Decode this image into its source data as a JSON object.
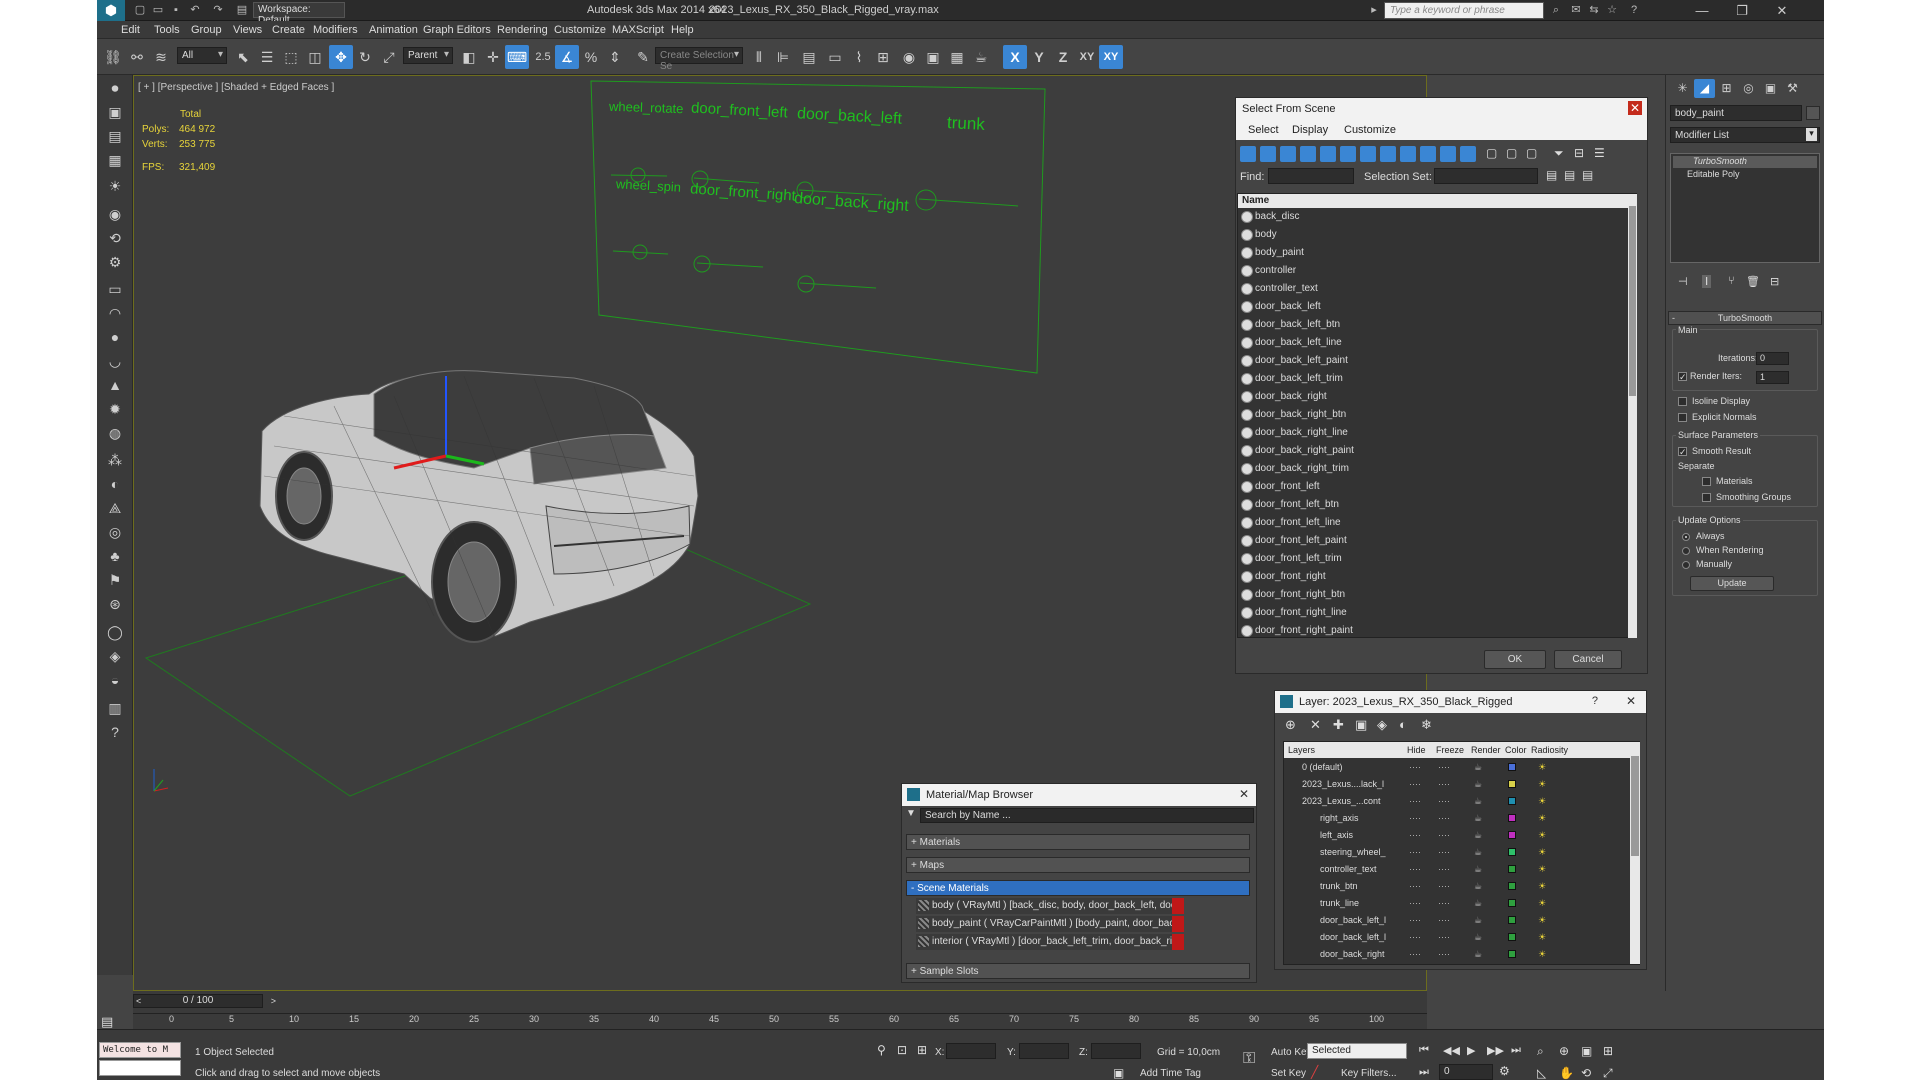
{
  "window": {
    "app_title": "Autodesk 3ds Max  2014 x64",
    "file_name": "2023_Lexus_RX_350_Black_Rigged_vray.max",
    "workspace": "Workspace: Default",
    "search_placeholder": "Type a keyword or phrase"
  },
  "menu": [
    "Edit",
    "Tools",
    "Group",
    "Views",
    "Create",
    "Modifiers",
    "Animation",
    "Graph Editors",
    "Rendering",
    "Customize",
    "MAXScript",
    "Help"
  ],
  "toolbar": {
    "selection_filter": "All",
    "reference_coord": "Parent",
    "snap_value": "2.5",
    "named_selection": "Create Selection Se",
    "axis_x": "X",
    "axis_y": "Y",
    "axis_z": "Z",
    "axis_xy": "XY",
    "axis_xy_active": "XY"
  },
  "viewport": {
    "label": "[ + ] [Perspective ] [Shaded + Edged Faces ]",
    "stats_header": "Total",
    "polys_label": "Polys:",
    "polys_value": "464 972",
    "verts_label": "Verts:",
    "verts_value": "253 775",
    "fps_label": "FPS:",
    "fps_value": "321,409",
    "controller_labels": {
      "wheel_rotate": "wheel_rotate",
      "door_front_left": "door_front_left",
      "door_back_left": "door_back_left",
      "trunk": "trunk",
      "wheel_spin": "wheel_spin",
      "door_front_right": "door_front_right",
      "door_back_right": "door_back_right"
    }
  },
  "select_from_scene": {
    "title": "Select From Scene",
    "menus": [
      "Select",
      "Display",
      "Customize"
    ],
    "find_label": "Find:",
    "selection_set_label": "Selection Set:",
    "column_name": "Name",
    "items": [
      "back_disc",
      "body",
      "body_paint",
      "controller",
      "controller_text",
      "door_back_left",
      "door_back_left_btn",
      "door_back_left_line",
      "door_back_left_paint",
      "door_back_left_trim",
      "door_back_right",
      "door_back_right_btn",
      "door_back_right_line",
      "door_back_right_paint",
      "door_back_right_trim",
      "door_front_left",
      "door_front_left_btn",
      "door_front_left_line",
      "door_front_left_paint",
      "door_front_left_trim",
      "door_front_right",
      "door_front_right_btn",
      "door_front_right_line",
      "door_front_right_paint"
    ],
    "ok": "OK",
    "cancel": "Cancel"
  },
  "layer_dialog": {
    "title": "Layer: 2023_Lexus_RX_350_Black_Rigged",
    "help": "?",
    "columns": [
      "Layers",
      "Hide",
      "Freeze",
      "Render",
      "Color",
      "Radiosity"
    ],
    "rows": [
      {
        "name": "0 (default)",
        "color": "#4a6fd8"
      },
      {
        "name": "2023_Lexus....lack_l",
        "color": "#d8d04a"
      },
      {
        "name": "2023_Lexus_...cont",
        "color": "#1f8fb0"
      },
      {
        "name": "right_axis",
        "color": "#c02fc0"
      },
      {
        "name": "left_axis",
        "color": "#c02fc0"
      },
      {
        "name": "steering_wheel_",
        "color": "#2fc06a"
      },
      {
        "name": "controller_text",
        "color": "#2fa03f"
      },
      {
        "name": "trunk_btn",
        "color": "#2fa03f"
      },
      {
        "name": "trunk_line",
        "color": "#2fa03f"
      },
      {
        "name": "door_back_left_l",
        "color": "#2fa03f"
      },
      {
        "name": "door_back_left_l",
        "color": "#2fa03f"
      },
      {
        "name": "door_back_right",
        "color": "#2fa03f"
      }
    ]
  },
  "material_browser": {
    "title": "Material/Map Browser",
    "search_placeholder": "Search by Name ...",
    "sections": [
      "+ Materials",
      "+ Maps",
      "- Scene Materials"
    ],
    "scene_materials": [
      "body ( VRayMtl ) [back_disc, body, door_back_left, door_back_...",
      "body_paint ( VRayCarPaintMtl ) [body_paint, door_back_left_pa...",
      "interior ( VRayMtl ) [door_back_left_trim, door_back_right_trim,..."
    ],
    "sample_slots": "+ Sample Slots"
  },
  "command_panel": {
    "object_name": "body_paint",
    "modifier_list": "Modifier List",
    "stack": [
      "TurboSmooth",
      "Editable Poly"
    ],
    "rollout_title": "TurboSmooth",
    "main_label": "Main",
    "iterations_label": "Iterations:",
    "iterations_value": "0",
    "render_iters_label": "Render Iters:",
    "render_iters_value": "1",
    "isoline_display": "Isoline Display",
    "explicit_normals": "Explicit Normals",
    "surface_parameters": "Surface Parameters",
    "smooth_result": "Smooth Result",
    "separate_label": "Separate",
    "materials": "Materials",
    "smoothing_groups": "Smoothing Groups",
    "update_options": "Update Options",
    "always": "Always",
    "when_rendering": "When Rendering",
    "manually": "Manually",
    "update_button": "Update"
  },
  "timeline": {
    "frame_counter": "0 / 100",
    "ticks": [
      "0",
      "5",
      "10",
      "15",
      "20",
      "25",
      "30",
      "35",
      "40",
      "45",
      "50",
      "55",
      "60",
      "65",
      "70",
      "75",
      "80",
      "85",
      "90",
      "95",
      "100"
    ]
  },
  "status": {
    "maxscript_listener": "Welcome to M",
    "selection_status": "1 Object Selected",
    "prompt": "Click and drag to select and move objects",
    "x_label": "X:",
    "y_label": "Y:",
    "z_label": "Z:",
    "grid": "Grid = 10,0cm",
    "auto_key": "Auto Key",
    "set_key": "Set Key",
    "key_mode": "Selected",
    "key_filters": "Key Filters...",
    "add_time_tag": "Add Time Tag",
    "current_frame": "0"
  }
}
